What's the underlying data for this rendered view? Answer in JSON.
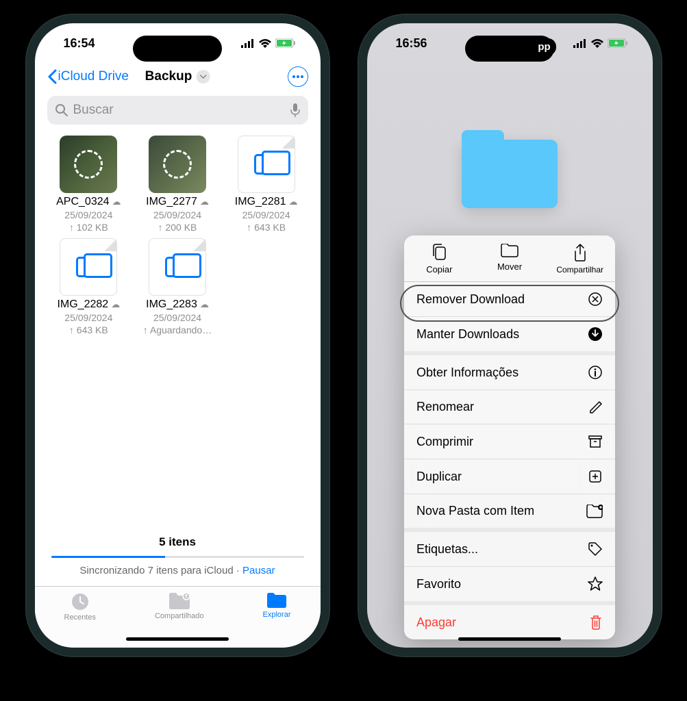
{
  "phone1": {
    "status": {
      "time": "16:54"
    },
    "nav": {
      "back": "iCloud Drive",
      "title": "Backup"
    },
    "search": {
      "placeholder": "Buscar"
    },
    "files": [
      {
        "name": "APC_0324",
        "date": "25/09/2024",
        "size": "↑ 102 KB",
        "kind": "photo1"
      },
      {
        "name": "IMG_2277",
        "date": "25/09/2024",
        "size": "↑ 200 KB",
        "kind": "photo2"
      },
      {
        "name": "IMG_2281",
        "date": "25/09/2024",
        "size": "↑ 643 KB",
        "kind": "doc"
      },
      {
        "name": "IMG_2282",
        "date": "25/09/2024",
        "size": "↑ 643 KB",
        "kind": "doc"
      },
      {
        "name": "IMG_2283",
        "date": "25/09/2024",
        "size": "↑ Aguardando…",
        "kind": "doc"
      }
    ],
    "sync": {
      "count": "5 itens",
      "text": "Sincronizando 7 itens para iCloud · ",
      "pause": "Pausar",
      "progress_pct": 45
    },
    "tabs": {
      "recent": "Recentes",
      "shared": "Compartilhado",
      "browse": "Explorar"
    }
  },
  "phone2": {
    "status": {
      "time": "16:56",
      "app_badge": "pp"
    },
    "top_actions": {
      "copy": "Copiar",
      "move": "Mover",
      "share": "Compartilhar"
    },
    "menu": [
      {
        "label": "Remover Download",
        "icon": "x-circle",
        "highlighted": true
      },
      {
        "label": "Manter Downloads",
        "icon": "download-circle",
        "sep_after": true
      },
      {
        "label": "Obter Informações",
        "icon": "info"
      },
      {
        "label": "Renomear",
        "icon": "pencil"
      },
      {
        "label": "Comprimir",
        "icon": "archive"
      },
      {
        "label": "Duplicar",
        "icon": "plus-square"
      },
      {
        "label": "Nova Pasta com Item",
        "icon": "folder-plus",
        "sep_after": true
      },
      {
        "label": "Etiquetas...",
        "icon": "tag"
      },
      {
        "label": "Favorito",
        "icon": "star",
        "sep_after": true
      },
      {
        "label": "Apagar",
        "icon": "trash",
        "danger": true
      }
    ]
  }
}
